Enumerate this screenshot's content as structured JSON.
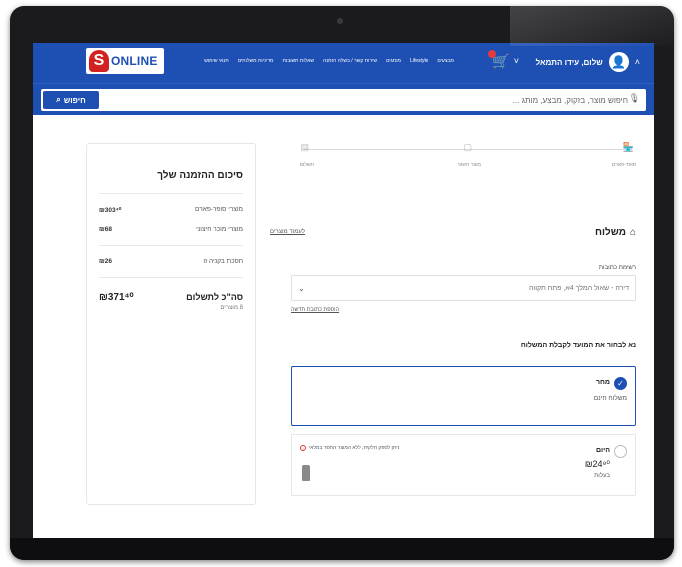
{
  "header": {
    "logo_text": "ONLINE",
    "logo_mark": "S",
    "user_greeting": "שלום, עידו התמאל",
    "user_avatar_icon": "user-icon",
    "cart_icon": "cart-icon",
    "brand_color": "#1e4fb3",
    "nav_links": [
      "מבצעים",
      "Lifestyle",
      "מותגים",
      "שירות קשר / בשלה הזמנה",
      "שאלות תשובות",
      "מדיניות משלוחים",
      "תנאי שימוש"
    ]
  },
  "search": {
    "placeholder": "חיפוש מוצר, בזקוק, מבצע, מותג ...",
    "button_label": "חיפוש",
    "mic_icon": "microphone-icon"
  },
  "steps": [
    {
      "label": "סופר-פארם",
      "icon": "store-icon",
      "state": "active"
    },
    {
      "label": "מוצר חיצוני",
      "icon": "box-icon",
      "state": "pending"
    },
    {
      "label": "תשלום",
      "icon": "payment-icon",
      "state": "pending"
    }
  ],
  "section": {
    "title": "משלוח",
    "back_link": "לעמוד מוצרים"
  },
  "address": {
    "label": "רשימת כתובות",
    "value": "דירה - שאול המלך 4א, פתח תקווה",
    "new_address_link": "הוספת כתובת חדשה"
  },
  "slot_prompt": "נא לבחור את המועד לקבלת המשלוח",
  "slots": {
    "tomorrow": {
      "name": "מחר",
      "sub": "משלוח חינם"
    },
    "today": {
      "name": "היום",
      "price": "₪24⁹⁰",
      "price_sub": "בעלות",
      "note": "ניתן לספק חלקית, ללא המוצר החסר במלאי"
    }
  },
  "summary": {
    "title": "סיכום ההזמנה שלך",
    "rows": [
      {
        "label": "מוצרי סופר-פארם",
        "amount": "₪303⁴⁰"
      },
      {
        "label": "מוצרי מוכר חיצוני",
        "amount": "₪68"
      }
    ],
    "bag_row": {
      "label": "חסכת בקניה זו",
      "amount": "₪26"
    },
    "total_label": "סה\"כ לתשלום",
    "total_sub": "8 מוצרים",
    "total_amount": "₪371⁴⁰"
  }
}
